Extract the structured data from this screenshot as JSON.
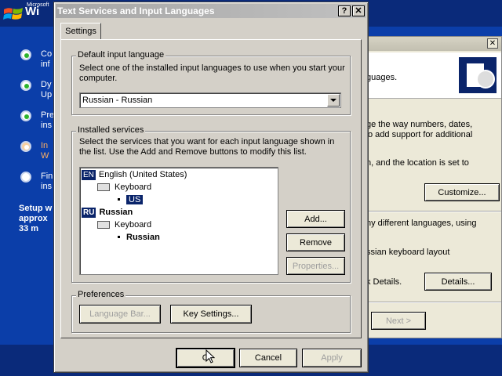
{
  "setup": {
    "logo_ms": "Microsoft",
    "logo_word": "Wi",
    "steps": [
      {
        "label": "Co\ninf"
      },
      {
        "label": "Dy\nUp"
      },
      {
        "label": "Pre\nins"
      },
      {
        "label": "In\nW"
      },
      {
        "label": "Fin\nins"
      }
    ],
    "time_text": "Setup w\napprox\n33 m"
  },
  "back_window": {
    "close_glyph": "✕",
    "header_text": "guages.",
    "text1": "ge the way numbers, dates,",
    "text2": "o add support for additional",
    "text3": "n, and the location is set to",
    "customize_label": "Customize...",
    "text4": "ny different languages, using",
    "text5": "ssian keyboard layout",
    "text6": "k Details.",
    "details_label": "Details...",
    "next_label": "Next >"
  },
  "dialog": {
    "title": "Text Services and Input Languages",
    "help_glyph": "?",
    "close_glyph": "✕",
    "tab_label": "Settings",
    "default_group_label": "Default input language",
    "default_desc": "Select one of the installed input languages to use when you start your computer.",
    "default_value": "Russian - Russian",
    "installed_group_label": "Installed services",
    "installed_desc": "Select the services that you want for each input language shown in the list. Use the Add and Remove buttons to modify this list.",
    "tree": {
      "lang1_code": "EN",
      "lang1_name": "English (United States)",
      "keyboard1": "Keyboard",
      "layout1": "US",
      "lang2_code": "RU",
      "lang2_name": "Russian",
      "keyboard2": "Keyboard",
      "layout2": "Russian"
    },
    "add_label": "Add...",
    "remove_label": "Remove",
    "properties_label": "Properties...",
    "preferences_label": "Preferences",
    "language_bar_label": "Language Bar...",
    "key_settings_label": "Key Settings...",
    "ok_label": "O",
    "cancel_label": "Cancel",
    "apply_label": "Apply"
  }
}
